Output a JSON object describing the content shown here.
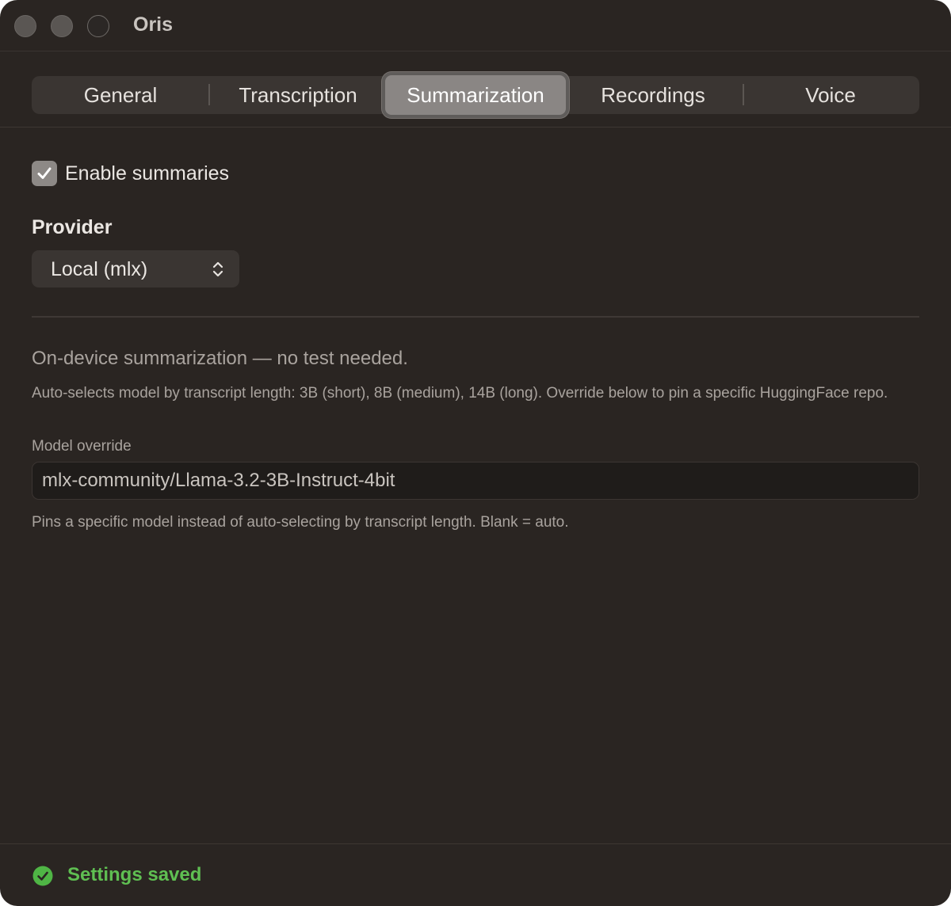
{
  "window": {
    "title": "Oris"
  },
  "tabs": [
    {
      "label": "General",
      "active": false
    },
    {
      "label": "Transcription",
      "active": false
    },
    {
      "label": "Summarization",
      "active": true
    },
    {
      "label": "Recordings",
      "active": false
    },
    {
      "label": "Voice",
      "active": false
    }
  ],
  "summaries": {
    "enable_label": "Enable summaries",
    "enabled": true
  },
  "provider": {
    "heading": "Provider",
    "selected": "Local (mlx)"
  },
  "local_info": {
    "status": "On-device summarization — no test needed.",
    "description": "Auto-selects model by transcript length: 3B (short), 8B (medium), 14B (long). Override below to pin a specific HuggingFace repo."
  },
  "model_override": {
    "label": "Model override",
    "value": "mlx-community/Llama-3.2-3B-Instruct-4bit",
    "hint": "Pins a specific model instead of auto-selecting by transcript length. Blank = auto."
  },
  "footer": {
    "status_text": "Settings saved",
    "status_color": "#5fbf52",
    "status_icon": "check-circle-icon"
  },
  "colors": {
    "window_bg": "#2a2522",
    "active_tab": "#8a8684",
    "success": "#5fbf52"
  }
}
